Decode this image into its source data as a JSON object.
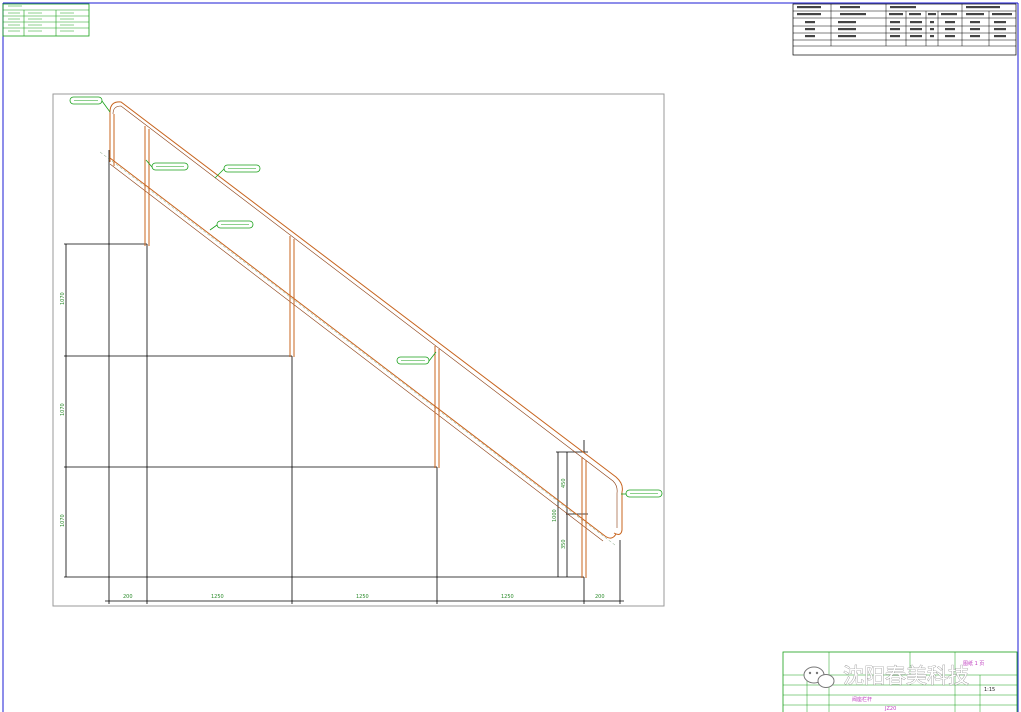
{
  "colors": {
    "border": "#1b1bd6",
    "green": "#18a018",
    "dim": "#000000",
    "pipe": "#c8641e",
    "magenta": "#c040c0",
    "frame": "#9a9a9a"
  },
  "drawing": {
    "dims": {
      "bottom": [
        "200",
        "1250",
        "1250",
        "1250",
        "200"
      ],
      "left": [
        "1070",
        "1070",
        "1070"
      ],
      "right_outer": "1000",
      "right_inner": [
        "450",
        "350"
      ]
    }
  },
  "title_block": {
    "name": "阀座栏杆",
    "code": "JZ20",
    "scale": "1:15",
    "sheet": "图纸 1 页"
  },
  "watermark": {
    "text": "沈阳春美科技"
  },
  "icons": {
    "wechat": "wechat-icon"
  }
}
